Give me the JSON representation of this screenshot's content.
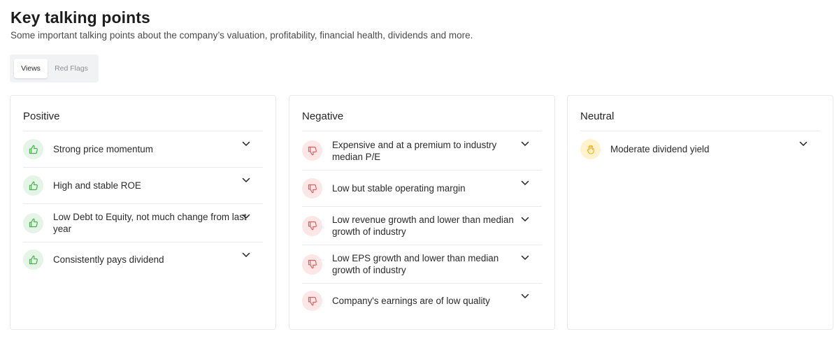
{
  "header": {
    "title": "Key talking points",
    "subtitle": "Some important talking points about the company’s valuation, profitability, financial health, dividends and more."
  },
  "tabs": [
    {
      "label": "Views",
      "active": true
    },
    {
      "label": "Red Flags",
      "active": false
    }
  ],
  "colors": {
    "positive_icon": "#4caf50",
    "negative_icon": "#e25c5c",
    "neutral_icon": "#f0b400"
  },
  "columns": {
    "positive": {
      "title": "Positive",
      "icon": "thumbs-up-icon",
      "items": [
        {
          "label": "Strong price momentum"
        },
        {
          "label": "High and stable ROE"
        },
        {
          "label": "Low Debt to Equity, not much change from last year"
        },
        {
          "label": "Consistently pays dividend"
        }
      ]
    },
    "negative": {
      "title": "Negative",
      "icon": "thumbs-down-icon",
      "items": [
        {
          "label": "Expensive and at a premium to industry median P/E"
        },
        {
          "label": "Low but stable operating margin"
        },
        {
          "label": "Low revenue growth and lower than median growth of industry"
        },
        {
          "label": "Low EPS growth and lower than median growth of industry"
        },
        {
          "label": "Company's earnings are of low quality"
        }
      ]
    },
    "neutral": {
      "title": "Neutral",
      "icon": "hand-neutral-icon",
      "items": [
        {
          "label": "Moderate dividend yield"
        }
      ]
    }
  }
}
